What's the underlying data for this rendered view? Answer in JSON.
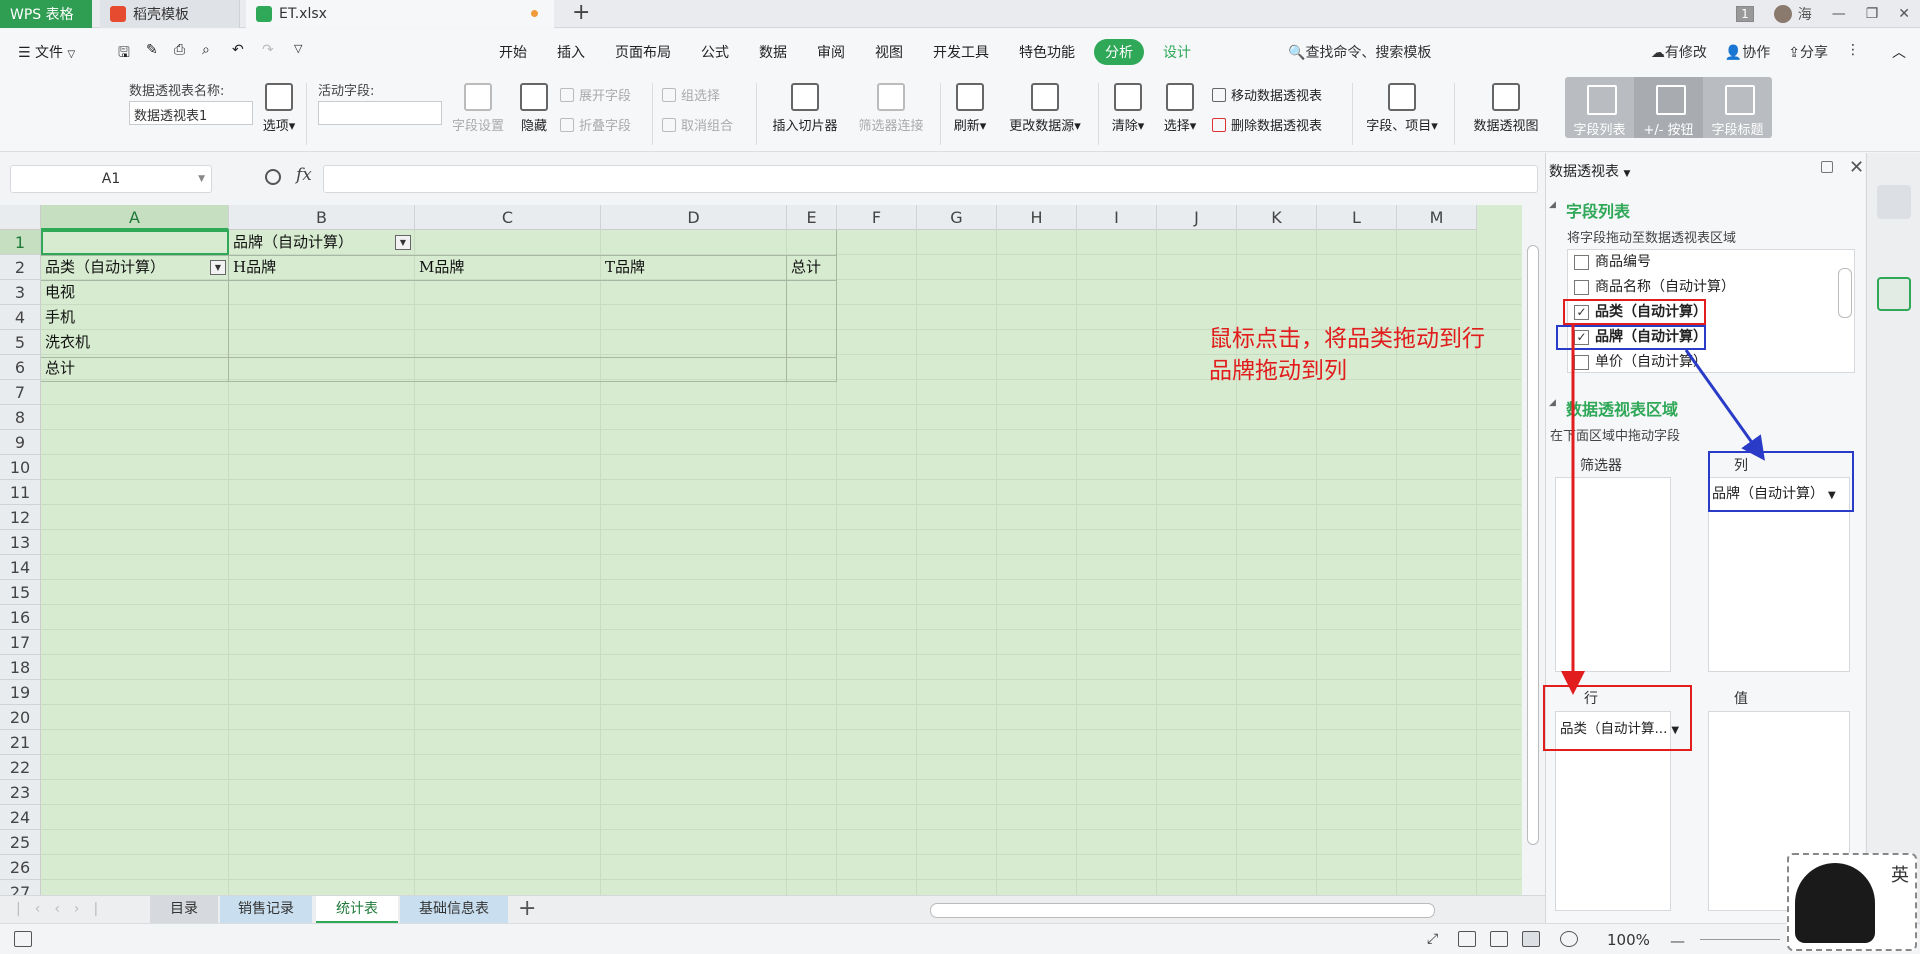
{
  "tabs": {
    "wps": "WPS 表格",
    "daoke": "稻壳模板",
    "file": "ET.xlsx"
  },
  "window": {
    "badge": "1",
    "user": "海"
  },
  "menu": {
    "file": "文件",
    "ribbon_tabs": [
      "开始",
      "插入",
      "页面布局",
      "公式",
      "数据",
      "审阅",
      "视图",
      "开发工具",
      "特色功能",
      "分析",
      "设计"
    ],
    "search": "查找命令、搜索模板",
    "actions": [
      "有修改",
      "协作",
      "分享"
    ]
  },
  "ribbon": {
    "pivot_name_label": "数据透视表名称:",
    "pivot_name_value": "数据透视表1",
    "options": "选项",
    "active_field_label": "活动字段:",
    "field_settings": "字段设置",
    "hide": "隐藏",
    "expand_field": "展开字段",
    "collapse_field": "折叠字段",
    "group_select": "组选择",
    "ungroup": "取消组合",
    "insert_slicer": "插入切片器",
    "filter_conn": "筛选器连接",
    "refresh": "刷新",
    "change_source": "更改数据源",
    "clear": "清除",
    "select": "选择",
    "move_pivot": "移动数据透视表",
    "delete_pivot": "删除数据透视表",
    "fields_items": "字段、项目",
    "pivot_chart": "数据透视图",
    "field_list": "字段列表",
    "buttons": "+/- 按钮",
    "field_headers": "字段标题"
  },
  "formula": {
    "namebox": "A1",
    "fx": "fx",
    "value": ""
  },
  "grid": {
    "columns": [
      "A",
      "B",
      "C",
      "D",
      "E",
      "F",
      "G",
      "H",
      "I",
      "J",
      "K",
      "L",
      "M"
    ],
    "rows": [
      "1",
      "2",
      "3",
      "4",
      "5",
      "6",
      "7",
      "8",
      "9",
      "10",
      "11",
      "12",
      "13",
      "14",
      "15",
      "16",
      "17",
      "18",
      "19",
      "20",
      "21",
      "22",
      "23",
      "24",
      "25",
      "26",
      "27"
    ],
    "cells": {
      "b1": "品牌（自动计算）",
      "a2": "品类（自动计算）",
      "b2": "H品牌",
      "c2": "M品牌",
      "d2": "T品牌",
      "e2": "总计",
      "a3": "电视",
      "a4": "手机",
      "a5": "洗衣机",
      "a6": "总计"
    },
    "annotation_line1": "鼠标点击，将品类拖动到行",
    "annotation_line2": "品牌拖动到列"
  },
  "sheets": [
    "目录",
    "销售记录",
    "统计表",
    "基础信息表"
  ],
  "status": {
    "zoom": "100%"
  },
  "panel": {
    "title": "数据透视表",
    "field_list_title": "字段列表",
    "field_list_hint": "将字段拖动至数据透视表区域",
    "fields": [
      {
        "label": "商品编号",
        "checked": false
      },
      {
        "label": "商品名称（自动计算）",
        "checked": false
      },
      {
        "label": "品类（自动计算）",
        "checked": true
      },
      {
        "label": "品牌（自动计算）",
        "checked": true
      },
      {
        "label": "单价（自动计算）",
        "checked": false
      }
    ],
    "area_title": "数据透视表区域",
    "area_hint": "在下面区域中拖动字段",
    "filter_label": "筛选器",
    "column_label": "列",
    "column_chip": "品牌（自动计算）",
    "row_label": "行",
    "row_chip": "品类（自动计算...",
    "value_label": "值"
  },
  "ime": {
    "key": "英"
  },
  "colors": {
    "accent": "#2fa858",
    "grid_bg": "#d7ebd0",
    "annotation_red": "#e11d1d",
    "annotation_blue": "#2a3cc7"
  }
}
